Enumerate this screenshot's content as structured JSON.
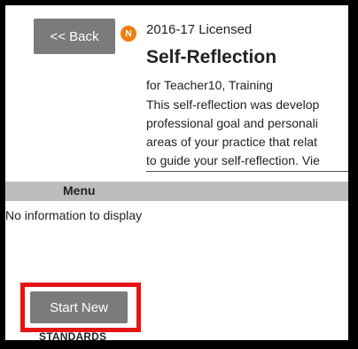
{
  "header": {
    "back_label": "<< Back",
    "badge_letter": "N",
    "badge_color": "#f07d12",
    "license_text": "2016-17 Licensed",
    "title": "Self-Reflection",
    "subtitle": "for Teacher10, Training",
    "description_lines": [
      "This self-reflection was develop",
      "professional goal and personali",
      "areas of your practice that relat",
      "to guide your self-reflection. Vie"
    ]
  },
  "menu": {
    "label": "Menu",
    "empty_text": "No information to display"
  },
  "actions": {
    "start_new_label": "Start New",
    "highlight_color": "#e51515"
  },
  "footer": {
    "standards_label": "STANDARDS"
  }
}
